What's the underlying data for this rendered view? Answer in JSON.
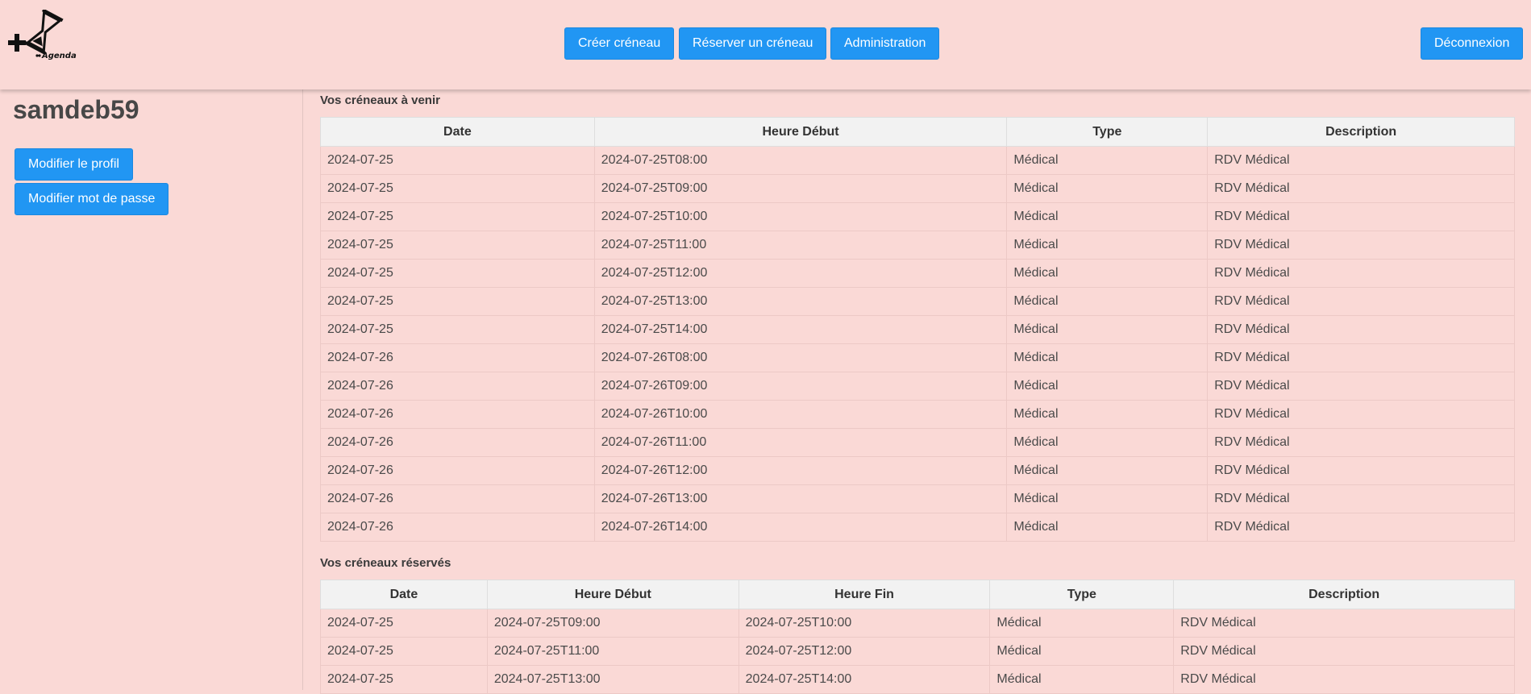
{
  "header": {
    "logo_text": "Agenda",
    "nav": {
      "create_slot": "Créer créneau",
      "book_slot": "Réserver un créneau",
      "admin": "Administration"
    },
    "logout": "Déconnexion"
  },
  "sidebar": {
    "username": "samdeb59",
    "edit_profile": "Modifier le profil",
    "edit_password": "Modifier mot de passe"
  },
  "upcoming": {
    "title": "Vos créneaux à venir",
    "columns": [
      "Date",
      "Heure Début",
      "Type",
      "Description"
    ],
    "rows": [
      [
        "2024-07-25",
        "2024-07-25T08:00",
        "Médical",
        "RDV Médical"
      ],
      [
        "2024-07-25",
        "2024-07-25T09:00",
        "Médical",
        "RDV Médical"
      ],
      [
        "2024-07-25",
        "2024-07-25T10:00",
        "Médical",
        "RDV Médical"
      ],
      [
        "2024-07-25",
        "2024-07-25T11:00",
        "Médical",
        "RDV Médical"
      ],
      [
        "2024-07-25",
        "2024-07-25T12:00",
        "Médical",
        "RDV Médical"
      ],
      [
        "2024-07-25",
        "2024-07-25T13:00",
        "Médical",
        "RDV Médical"
      ],
      [
        "2024-07-25",
        "2024-07-25T14:00",
        "Médical",
        "RDV Médical"
      ],
      [
        "2024-07-26",
        "2024-07-26T08:00",
        "Médical",
        "RDV Médical"
      ],
      [
        "2024-07-26",
        "2024-07-26T09:00",
        "Médical",
        "RDV Médical"
      ],
      [
        "2024-07-26",
        "2024-07-26T10:00",
        "Médical",
        "RDV Médical"
      ],
      [
        "2024-07-26",
        "2024-07-26T11:00",
        "Médical",
        "RDV Médical"
      ],
      [
        "2024-07-26",
        "2024-07-26T12:00",
        "Médical",
        "RDV Médical"
      ],
      [
        "2024-07-26",
        "2024-07-26T13:00",
        "Médical",
        "RDV Médical"
      ],
      [
        "2024-07-26",
        "2024-07-26T14:00",
        "Médical",
        "RDV Médical"
      ]
    ]
  },
  "reserved": {
    "title": "Vos créneaux réservés",
    "columns": [
      "Date",
      "Heure Début",
      "Heure Fin",
      "Type",
      "Description"
    ],
    "rows": [
      [
        "2024-07-25",
        "2024-07-25T09:00",
        "2024-07-25T10:00",
        "Médical",
        "RDV Médical"
      ],
      [
        "2024-07-25",
        "2024-07-25T11:00",
        "2024-07-25T12:00",
        "Médical",
        "RDV Médical"
      ],
      [
        "2024-07-25",
        "2024-07-25T13:00",
        "2024-07-25T14:00",
        "Médical",
        "RDV Médical"
      ]
    ]
  },
  "colors": {
    "background": "#fad9d6",
    "button": "#2196f3",
    "header_cell": "#f2f2f2"
  }
}
